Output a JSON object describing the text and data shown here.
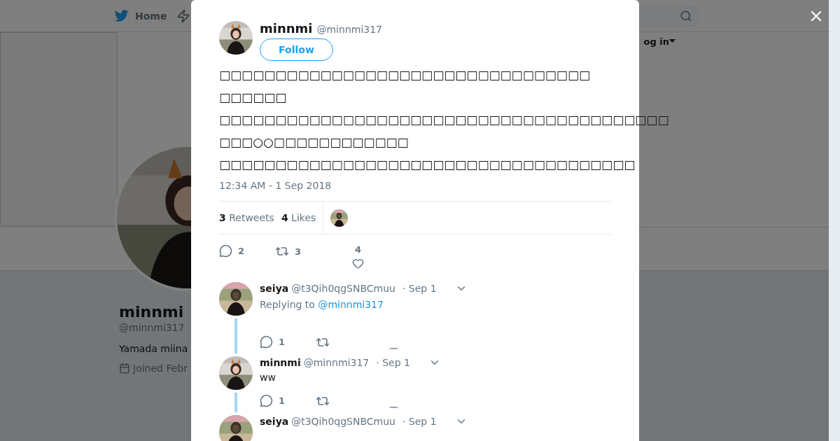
{
  "top_nav": {
    "home": "Home",
    "login": "og in"
  },
  "profile": {
    "name": "minnmi",
    "handle": "@minnmi317",
    "bio": "Yamada miina",
    "joined": "Joined Febr"
  },
  "tweet": {
    "name": "minnmi",
    "handle": "@minnmi317",
    "follow": "Follow",
    "text_lines": [
      "□□□□□□□□□□□□□□□□□□□□□□□□□□□□□□□□□",
      "□□□□□□",
      "□□□□□□□□□□□□□□□□□□□□□□□□□□□□□□□□□□□□□□□□",
      "□□□○○□□□□□□□□□□□□",
      "□□□□□□□□□□□□□□□□□□□□□□□□□□□□□□□□□□□□□"
    ],
    "timestamp": "12:34 AM - 1 Sep 2018",
    "stats": [
      {
        "count": "3",
        "label": "Retweets"
      },
      {
        "count": "4",
        "label": "Likes"
      }
    ],
    "actions": {
      "replies": "2",
      "retweets": "3",
      "likes": "4"
    }
  },
  "replies": [
    {
      "name": "seiya",
      "handle": "@t3Qih0qgSNBCmuu",
      "date": "· Sep 1",
      "replying_to_label": "Replying to",
      "replying_to": "@minnmi317",
      "reply_count": "1"
    },
    {
      "name": "minnmi",
      "handle": "@minnmi317",
      "date": "· Sep 1",
      "text": "ww",
      "reply_count": "1"
    },
    {
      "name": "seiya",
      "handle": "@t3Qih0qgSNBCmuu",
      "date": "· Sep 1"
    }
  ]
}
